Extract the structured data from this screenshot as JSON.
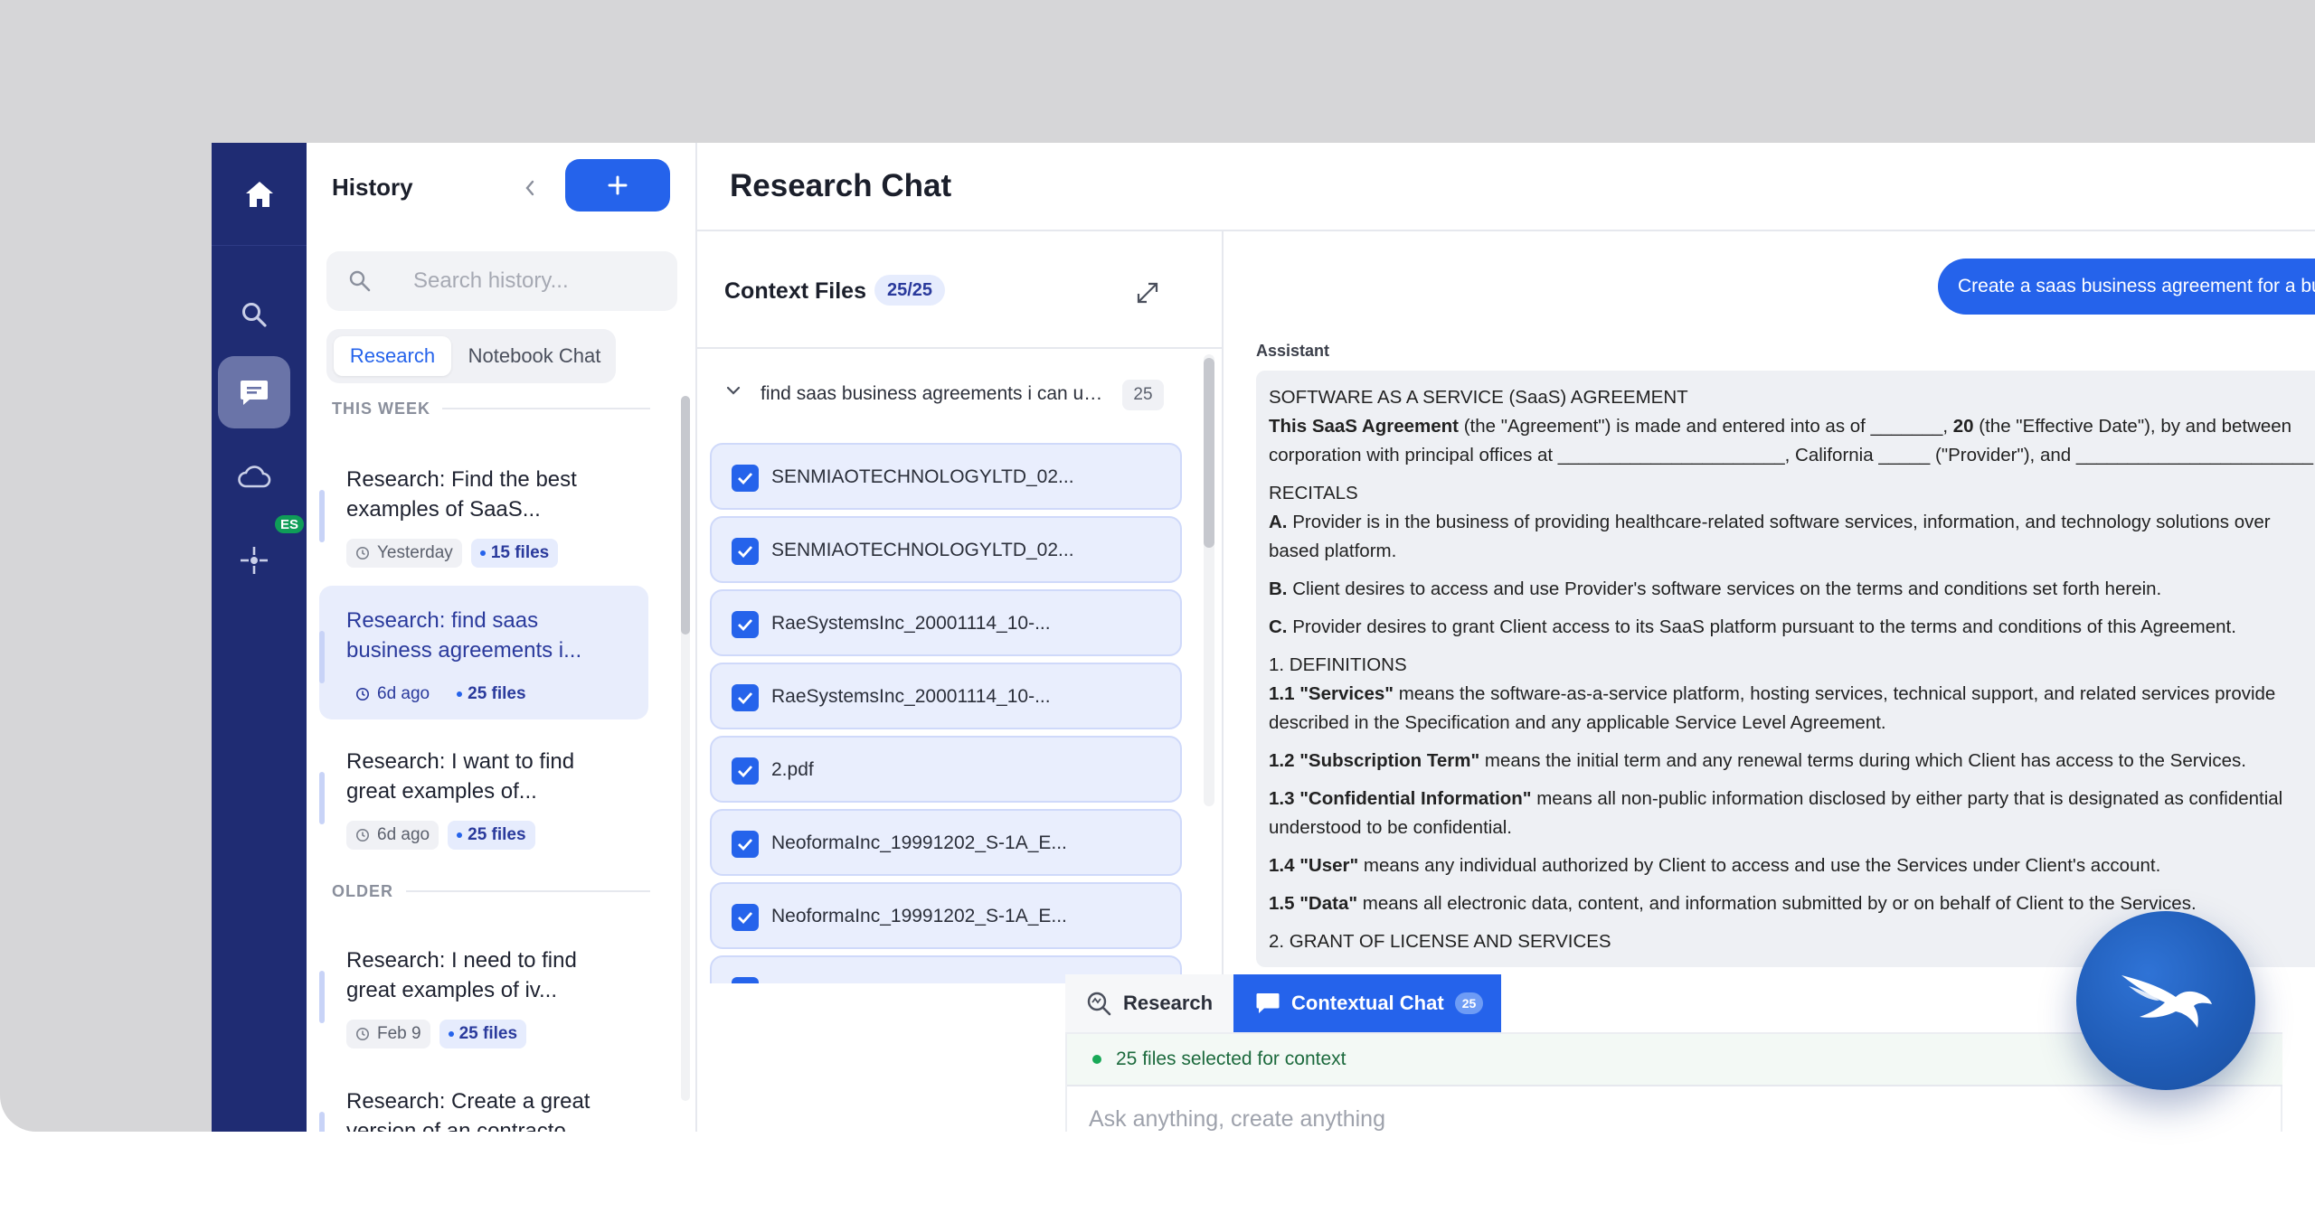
{
  "rail": {
    "icons": [
      "home-icon",
      "search-icon",
      "chat-icon",
      "cloud-icon",
      "integrations-icon"
    ],
    "badge": "ES"
  },
  "history": {
    "title": "History",
    "search_placeholder": "Search history...",
    "tabs": [
      "Research",
      "Notebook Chat"
    ],
    "section_this_week": "THIS WEEK",
    "section_older": "OLDER",
    "items": [
      {
        "title": "Research: Find the best examples of SaaS...",
        "time": "Yesterday",
        "files": "15 files"
      },
      {
        "title": "Research: find saas business agreements i...",
        "time": "6d ago",
        "files": "25 files"
      },
      {
        "title": "Research: I want to find great examples of...",
        "time": "6d ago",
        "files": "25 files"
      },
      {
        "title": "Research: I need to find great examples of iv...",
        "time": "Feb 9",
        "files": "25 files"
      },
      {
        "title": "Research: Create a great version of an contracto...",
        "time": "",
        "files": ""
      }
    ]
  },
  "main": {
    "title": "Research Chat"
  },
  "context": {
    "title": "Context Files",
    "count": "25/25",
    "query": "find saas business agreements i can us...",
    "query_count": "25",
    "files": [
      "SENMIAOTECHNOLOGYLTD_02...",
      "SENMIAOTECHNOLOGYLTD_02...",
      "RaeSystemsInc_20001114_10-...",
      "RaeSystemsInc_20001114_10-...",
      "2.pdf",
      "NeoformaInc_19991202_S-1A_E...",
      "NeoformaInc_19991202_S-1A_E...",
      ""
    ]
  },
  "chat": {
    "user_message": "Create a saas business agreement for a bus",
    "assistant_label": "Assistant",
    "doc": {
      "heading": "SOFTWARE AS A SERVICE (SaaS) AGREEMENT",
      "intro_b": "This SaaS Agreement",
      "intro_1": " (the \"Agreement\") is made and entered into as of _______, ",
      "intro_b2": "20",
      "intro_2": " (the \"Effective Date\"), by and between",
      "intro_line2": "corporation with principal offices at ______________________, California _____ (\"Provider\"), and _______________________ (\"Cl",
      "recitals": "RECITALS",
      "a_b": "A.",
      "a": " Provider is in the business of providing healthcare-related software services, information, and technology solutions over",
      "a2": "based platform.",
      "b_b": "B.",
      "b": " Client desires to access and use Provider's software services on the terms and conditions set forth herein.",
      "c_b": "C.",
      "c": " Provider desires to grant Client access to its SaaS platform pursuant to the terms and conditions of this Agreement.",
      "defs": "1. DEFINITIONS",
      "d11_b": "1.1 \"Services\"",
      "d11": " means the software-as-a-service platform, hosting services, technical support, and related services provide",
      "d11b": "described in the Specification and any applicable Service Level Agreement.",
      "d12_b": "1.2 \"Subscription Term\"",
      "d12": " means the initial term and any renewal terms during which Client has access to the Services.",
      "d13_b": "1.3 \"Confidential Information\"",
      "d13": " means all non-public information disclosed by either party that is designated as confidential",
      "d13b": "understood to be confidential.",
      "d14_b": "1.4 \"User\"",
      "d14": " means any individual authorized by Client to access and use the Services under Client's account.",
      "d15_b": "1.5 \"Data\"",
      "d15": " means all electronic data, content, and information submitted by or on behalf of Client to the Services.",
      "grant": "2. GRANT OF LICENSE AND SERVICES"
    }
  },
  "composer": {
    "tab_research": "Research",
    "tab_contextual": "Contextual Chat",
    "tab_contextual_count": "25",
    "status": "25 files selected for context",
    "placeholder": "Ask anything, create anything"
  },
  "colors": {
    "rail": "#1f2c73",
    "accent": "#2563eb",
    "selected_item": "#e8edfc",
    "status_green": "#18a957"
  }
}
